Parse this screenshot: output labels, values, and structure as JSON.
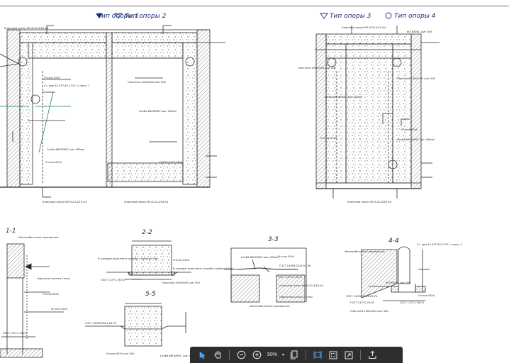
{
  "titles": {
    "support_type_1": "Тип опоры 1",
    "support_type_2": "Тип опоры 2",
    "support_type_3": "Тип опоры 3",
    "support_type_4": "Тип опоры 4"
  },
  "sections": {
    "s11": "1-1",
    "s22": "2-2",
    "s33": "3-3",
    "s44": "4-4",
    "s55": "5-5"
  },
  "notes": {
    "n1": "Клиновой анкер М2 В-20-4/16 А4",
    "n2": "Пластина 100х50х5 шаг 500",
    "n3": "Уголок 63х5",
    "n4": "Скоба ФВ 6800С шаг 400мм",
    "n5": "Ст. арм 10 АТР-АР-2133 ст прил. 1",
    "n6": "ГОСТ 14771-76-Н1",
    "n7": "ГОСТ 14098-2014-Н1-Рв",
    "n8": "Наружная кромка стены",
    "n9": "Железобетонное перекрытие",
    "n10": "Уголок 63х5 шаг 500",
    "n11": "ФЛ 6800С шаг 500",
    "n12": "В клиндре выполнить штрабу глубиной 5мм"
  },
  "toolbar": {
    "zoom_value": "50%",
    "zoom_dropdown": "▾",
    "buttons": [
      {
        "icon": "select-arrow-icon",
        "active": true
      },
      {
        "icon": "pan-hand-icon",
        "active": false
      },
      {
        "icon": "zoom-out-icon",
        "active": false
      },
      {
        "icon": "zoom-in-icon",
        "active": false
      },
      {
        "icon": "fit-page-icon",
        "active": false
      },
      {
        "icon": "fit-width-icon",
        "active": true
      },
      {
        "icon": "snapshot-icon",
        "active": false
      },
      {
        "icon": "fullscreen-icon",
        "active": false
      },
      {
        "icon": "upload-icon",
        "active": false
      }
    ]
  },
  "colors": {
    "drawing_line": "#2b2b2b",
    "title_blue": "#1f2f7a",
    "accent_blue": "#4aa3ff",
    "toolbar_bg": "#2e2e2e"
  }
}
